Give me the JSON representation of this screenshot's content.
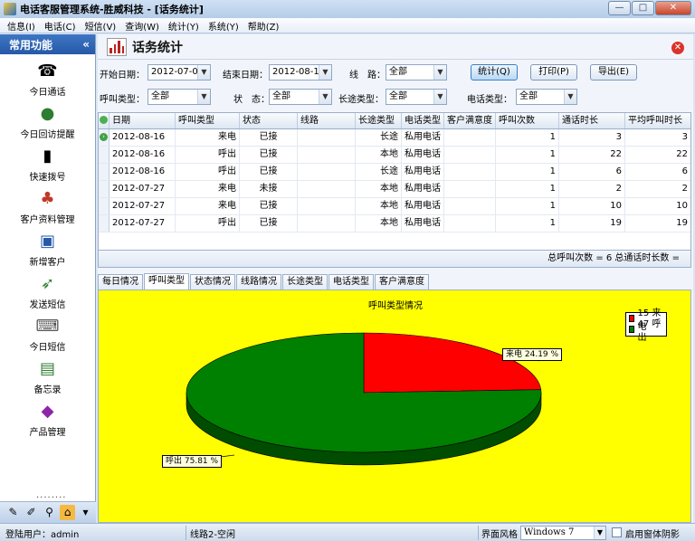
{
  "window": {
    "title": "电话客服管理系统-胜威科技 - [话务统计]",
    "controls": [
      "—",
      "□",
      "✕"
    ]
  },
  "menu": [
    "信息(I)",
    "电话(C)",
    "短信(V)",
    "查询(W)",
    "统计(Y)",
    "系统(Y)",
    "帮助(Z)"
  ],
  "sidebar": {
    "title": "常用功能",
    "collapse": "«",
    "items": [
      {
        "label": "今日通话",
        "icon": "telephone-icon"
      },
      {
        "label": "今日回访提醒",
        "icon": "person-globe-icon"
      },
      {
        "label": "快速拨号",
        "icon": "mobile-phone-icon"
      },
      {
        "label": "客户资料管理",
        "icon": "contacts-icon"
      },
      {
        "label": "新增客户",
        "icon": "id-card-icon"
      },
      {
        "label": "发送短信",
        "icon": "send-message-icon"
      },
      {
        "label": "今日短信",
        "icon": "laptop-message-icon"
      },
      {
        "label": "备忘录",
        "icon": "memo-icon"
      },
      {
        "label": "产品管理",
        "icon": "product-icon"
      }
    ],
    "dots": "........",
    "tools": [
      "wrench-icon",
      "pen-icon",
      "magnify-icon",
      "home-icon",
      "dropdown-arrow-icon"
    ]
  },
  "panel": {
    "title": "话务统计"
  },
  "filters": {
    "start_date_label": "开始日期：",
    "start_date": "2012-07-01",
    "end_date_label": "结束日期：",
    "end_date": "2012-08-16",
    "line_label": "线　路：",
    "line_value": "全部",
    "call_type_label": "呼叫类型：",
    "call_type_value": "全部",
    "status_label": "状　态：",
    "status_value": "全部",
    "long_type_label": "长途类型：",
    "long_type_value": "全部",
    "phone_type_label": "电话类型：",
    "phone_type_value": "全部",
    "btn_stats": "统计(Q)",
    "btn_print": "打印(P)",
    "btn_export": "导出(E)"
  },
  "table": {
    "columns": [
      "日期",
      "呼叫类型",
      "状态",
      "线路",
      "长途类型",
      "电话类型",
      "客户满意度",
      "呼叫次数",
      "通话时长",
      "平均呼叫时长"
    ],
    "rows": [
      [
        "2012-08-16",
        "来电",
        "已接",
        "",
        "长途",
        "私用电话",
        "",
        "1",
        "3",
        "3"
      ],
      [
        "2012-08-16",
        "呼出",
        "已接",
        "",
        "本地",
        "私用电话",
        "",
        "1",
        "22",
        "22"
      ],
      [
        "2012-08-16",
        "呼出",
        "已接",
        "",
        "长途",
        "私用电话",
        "",
        "1",
        "6",
        "6"
      ],
      [
        "2012-07-27",
        "来电",
        "未接",
        "",
        "本地",
        "私用电话",
        "",
        "1",
        "2",
        "2"
      ],
      [
        "2012-07-27",
        "来电",
        "已接",
        "",
        "本地",
        "私用电话",
        "",
        "1",
        "10",
        "10"
      ],
      [
        "2012-07-27",
        "呼出",
        "已接",
        "",
        "本地",
        "私用电话",
        "",
        "1",
        "19",
        "19"
      ]
    ],
    "footer": "总呼叫次数 = 6  总通话时长数 ="
  },
  "tabs": [
    "每日情况",
    "呼叫类型",
    "状态情况",
    "线路情况",
    "长途类型",
    "电话类型",
    "客户满意度"
  ],
  "active_tab": 1,
  "chart_data": {
    "type": "pie",
    "title": "呼叫类型情况",
    "categories": [
      "来电",
      "呼出"
    ],
    "values": [
      15,
      47
    ],
    "percent_labels": [
      "24.19 %",
      "75.81 %"
    ],
    "legend": [
      "15 来电",
      "47 呼出"
    ],
    "colors": [
      "#ff0000",
      "#008000"
    ],
    "legend_position": "top-right"
  },
  "status": {
    "user": "登陆用户：admin",
    "line": "线路2-空闲",
    "skin_label": "界面风格",
    "skin_value": "Windows 7",
    "shadow_label": "启用窗体阴影"
  }
}
